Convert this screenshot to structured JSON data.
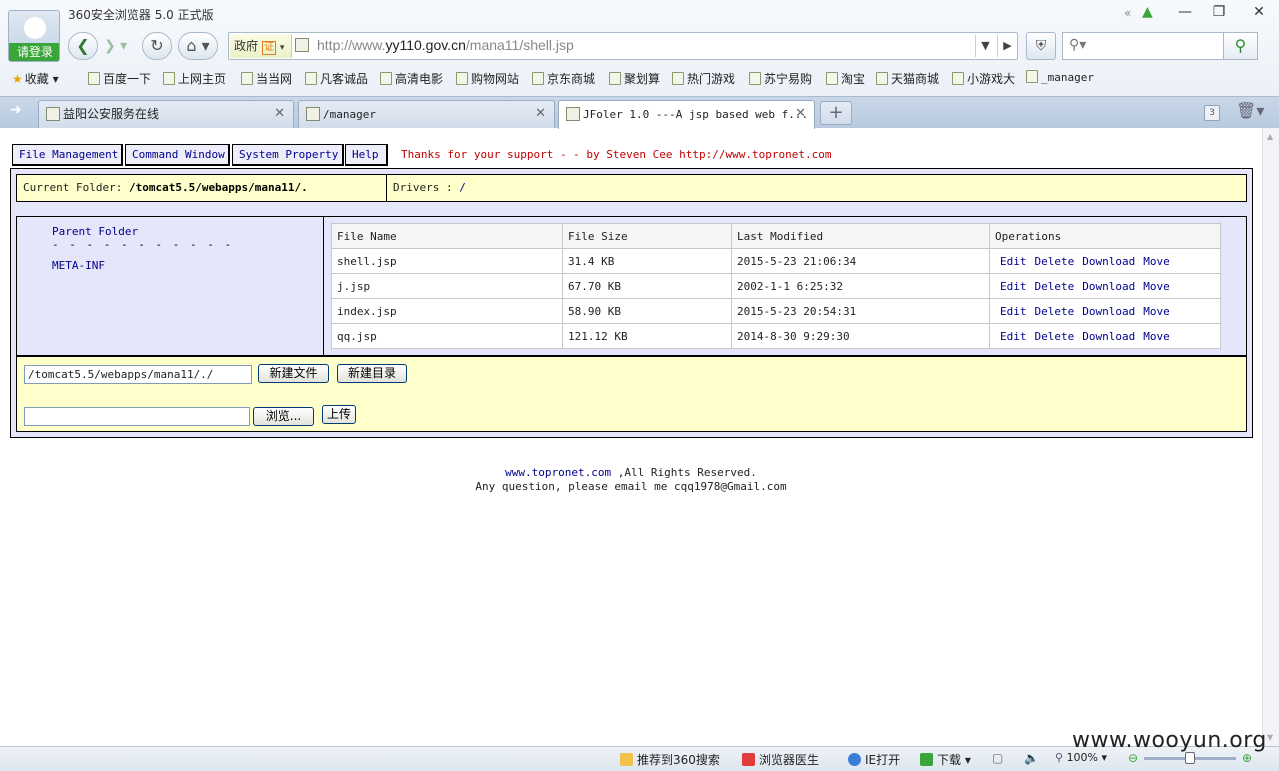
{
  "browser": {
    "login_label": "请登录",
    "window_title": "360安全浏览器 5.0 正式版",
    "minimize": "—",
    "restore": "❐",
    "close": "✕",
    "gov_badge": "政府",
    "gov_cert": "证",
    "url_prefix": "http://www.",
    "url_host": "yy110.gov.cn",
    "url_path": "/mana11/shell.jsp",
    "icons": [
      "back-icon",
      "forward-icon",
      "refresh-icon",
      "home-icon",
      "shield-icon",
      "search-icon"
    ]
  },
  "bookmarks": {
    "favorites_label": "收藏",
    "items": [
      "百度一下",
      "上网主页",
      "当当网",
      "凡客诚品",
      "高清电影",
      "购物网站",
      "京东商城",
      "聚划算",
      "热门游戏",
      "苏宁易购",
      "淘宝",
      "天猫商城",
      "小游戏大",
      "_manager"
    ]
  },
  "tabs": [
    {
      "label": "益阳公安服务在线",
      "close": "✕"
    },
    {
      "label": "/manager",
      "close": "✕"
    },
    {
      "label": "JFoler 1.0 ---A jsp based web f...",
      "close": "✕"
    }
  ],
  "tab_count": "3",
  "page": {
    "menu": [
      "File Management",
      "Command Window",
      "System Property",
      "Help"
    ],
    "thanks": "Thanks for your support - - by Steven Cee http://www.topronet.com",
    "current_folder_label": "Current Folder: ",
    "current_folder_value": "/tomcat5.5/webapps/mana11/.",
    "drivers_label": "Drivers : ",
    "drivers_value": "/",
    "parent_folder": "Parent Folder",
    "dash_line": "- - - - - - - - - - -",
    "folders": [
      "META-INF"
    ],
    "table_headers": [
      "File Name",
      "File Size",
      "Last Modified",
      "Operations"
    ],
    "files": [
      {
        "name": "shell.jsp",
        "size": "31.4 KB",
        "modified": "2015-5-23 21:06:34"
      },
      {
        "name": "j.jsp",
        "size": "67.70 KB",
        "modified": "2002-1-1 6:25:32"
      },
      {
        "name": "index.jsp",
        "size": "58.90 KB",
        "modified": "2015-5-23 20:54:31"
      },
      {
        "name": "qq.jsp",
        "size": "121.12 KB",
        "modified": "2014-8-30 9:29:30"
      }
    ],
    "operations": [
      "Edit",
      "Delete",
      "Download",
      "Move"
    ],
    "path_input_value": "/tomcat5.5/webapps/mana11/./",
    "new_file_button": "新建文件",
    "new_dir_button": "新建目录",
    "upload_input_value": "",
    "browse_button": "浏览...",
    "upload_button": "上传",
    "footer_link": "www.topronet.com",
    "footer_rights": " ,All Rights Reserved.",
    "footer_email": "Any question, please email me cqq1978@Gmail.com"
  },
  "statusbar": {
    "recommend": "推荐到360搜索",
    "doctor": "浏览器医生",
    "ie_open": "IE打开",
    "download": "下载",
    "zoom": "100%",
    "zoom_fraction": 0.5
  },
  "watermark": "www.wooyun.org",
  "colors": {
    "link_blue": "#00008b",
    "thanks_red": "#c00000",
    "panel_lavender": "#e6e6fa",
    "panel_yellow": "#ffffcc",
    "login_green": "#3aa63a"
  }
}
